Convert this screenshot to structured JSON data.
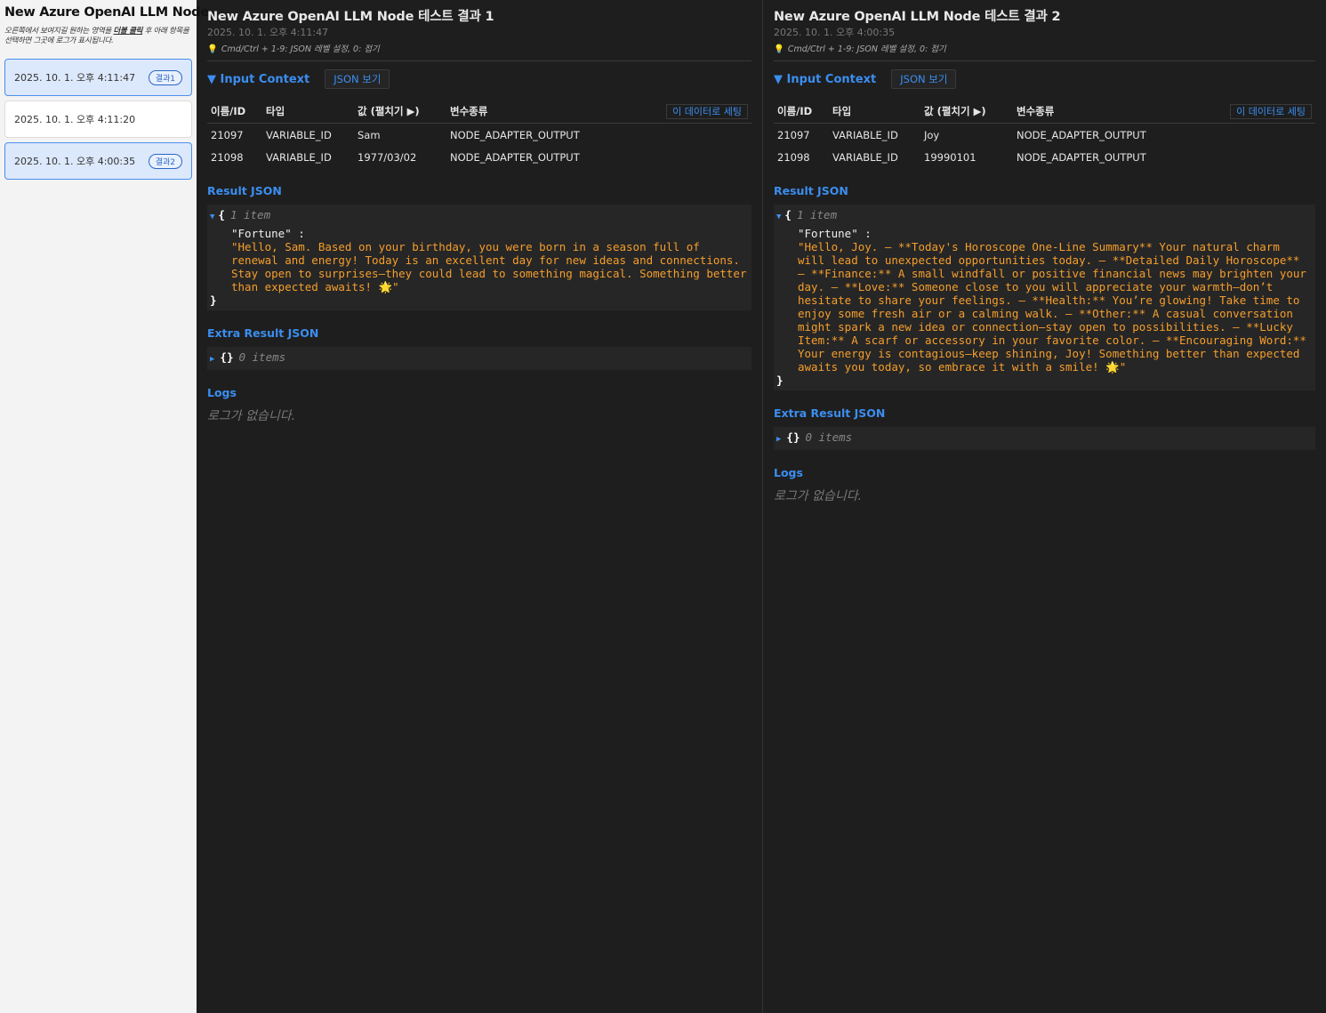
{
  "sidebar": {
    "title": "New Azure OpenAI LLM Node",
    "hint_pre": "오른쪽에서 보여지길 원하는 영역을 ",
    "hint_bold": "더블 클릭",
    "hint_post": " 후 아래 항목을 선택하면 그곳에 로그가 표시됩니다.",
    "items": [
      {
        "date": "2025. 10. 1. 오후 4:11:47",
        "badge": "결과1",
        "selected": true
      },
      {
        "date": "2025. 10. 1. 오후 4:11:20",
        "badge": "",
        "selected": false
      },
      {
        "date": "2025. 10. 1. 오후 4:00:35",
        "badge": "결과2",
        "selected": true
      }
    ]
  },
  "shortcut_hint": "Cmd/Ctrl + 1-9: JSON 레벨 설정, 0: 접기",
  "labels": {
    "input_context": "▼ Input Context",
    "json_view": "JSON 보기",
    "col_name": "이름/ID",
    "col_type": "타입",
    "col_value": "값 (펼치기 ▶)",
    "col_kind": "변수종류",
    "set_data": "이 데이터로 세팅",
    "result_json": "Result JSON",
    "extra_result_json": "Extra Result JSON",
    "logs": "Logs",
    "no_logs": "로그가 없습니다.",
    "one_item": "1 item",
    "zero_items": "0 items",
    "fortune_key": "\"Fortune\" :"
  },
  "panels": [
    {
      "title": "New Azure OpenAI LLM Node 테스트 결과 1",
      "date": "2025. 10. 1. 오후 4:11:47",
      "rows": [
        {
          "id": "21097",
          "type": "VARIABLE_ID",
          "value": "Sam",
          "kind": "NODE_ADAPTER_OUTPUT"
        },
        {
          "id": "21098",
          "type": "VARIABLE_ID",
          "value": "1977/03/02",
          "kind": "NODE_ADAPTER_OUTPUT"
        }
      ],
      "fortune": "\"Hello, Sam. Based on your birthday, you were born in a season full of renewal and energy! Today is an excellent day for new ideas and connections. Stay open to surprises—they could lead to something magical. Something better than expected awaits! 🌟\""
    },
    {
      "title": "New Azure OpenAI LLM Node 테스트 결과 2",
      "date": "2025. 10. 1. 오후 4:00:35",
      "rows": [
        {
          "id": "21097",
          "type": "VARIABLE_ID",
          "value": "Joy",
          "kind": "NODE_ADAPTER_OUTPUT"
        },
        {
          "id": "21098",
          "type": "VARIABLE_ID",
          "value": "19990101",
          "kind": "NODE_ADAPTER_OUTPUT"
        }
      ],
      "fortune": "\"Hello, Joy. – **Today's Horoscope One-Line Summary** Your natural charm will lead to unexpected opportunities today. – **Detailed Daily Horoscope** – **Finance:** A small windfall or positive financial news may brighten your day. – **Love:** Someone close to you will appreciate your warmth—don’t hesitate to share your feelings. – **Health:** You’re glowing! Take time to enjoy some fresh air or a calming walk. – **Other:** A casual conversation might spark a new idea or connection—stay open to possibilities. – **Lucky Item:** A scarf or accessory in your favorite color. – **Encouraging Word:** Your energy is contagious—keep shining, Joy! Something better than expected awaits you today, so embrace it with a smile! 🌟\""
    }
  ]
}
